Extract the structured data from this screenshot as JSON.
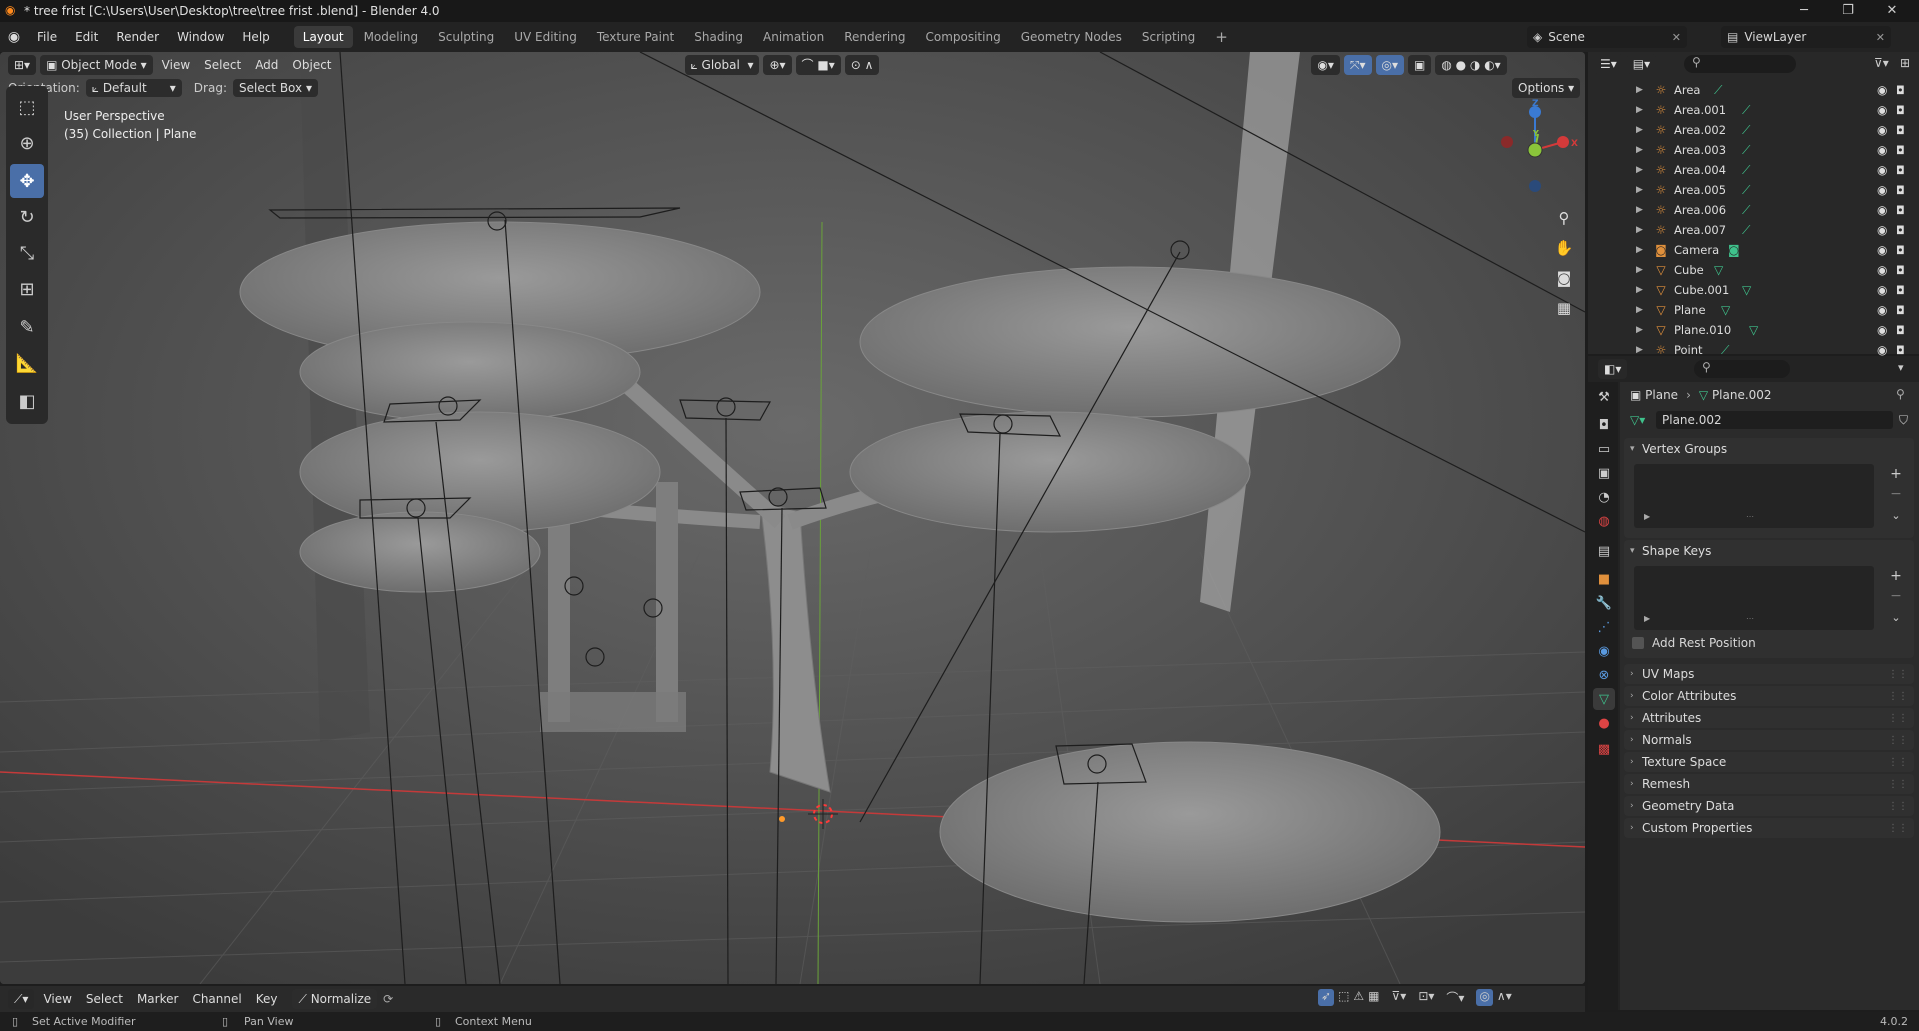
{
  "titlebar": {
    "title": "* tree frist  [C:\\Users\\User\\Desktop\\tree\\tree frist .blend] - Blender 4.0"
  },
  "menus": [
    "File",
    "Edit",
    "Render",
    "Window",
    "Help"
  ],
  "workspaces": [
    "Layout",
    "Modeling",
    "Sculpting",
    "UV Editing",
    "Texture Paint",
    "Shading",
    "Animation",
    "Rendering",
    "Compositing",
    "Geometry Nodes",
    "Scripting"
  ],
  "top_right": {
    "scene": "Scene",
    "viewlayer": "ViewLayer"
  },
  "viewport_header": {
    "mode": "Object Mode",
    "menus": [
      "View",
      "Select",
      "Add",
      "Object"
    ],
    "transform": "Global",
    "orientation_label": "Orientation:",
    "orientation_value": "Default",
    "drag_label": "Drag:",
    "drag_value": "Select Box",
    "options": "Options"
  },
  "viewport": {
    "perspective": "User Perspective",
    "collection": "(35) Collection | Plane"
  },
  "gizmo": {
    "z": "Z",
    "y": "Y",
    "x": "X"
  },
  "outliner": {
    "items": [
      {
        "name": "Area",
        "icon": "light-icon"
      },
      {
        "name": "Area.001",
        "icon": "light-icon"
      },
      {
        "name": "Area.002",
        "icon": "light-icon"
      },
      {
        "name": "Area.003",
        "icon": "light-icon"
      },
      {
        "name": "Area.004",
        "icon": "light-icon"
      },
      {
        "name": "Area.005",
        "icon": "light-icon"
      },
      {
        "name": "Area.006",
        "icon": "light-icon"
      },
      {
        "name": "Area.007",
        "icon": "light-icon"
      },
      {
        "name": "Camera",
        "icon": "camera-icon"
      },
      {
        "name": "Cube",
        "icon": "mesh-icon"
      },
      {
        "name": "Cube.001",
        "icon": "mesh-icon"
      },
      {
        "name": "Plane",
        "icon": "mesh-icon"
      },
      {
        "name": "Plane.010",
        "icon": "mesh-icon"
      },
      {
        "name": "Point",
        "icon": "light-icon"
      }
    ]
  },
  "properties": {
    "breadcrumb_object": "Plane",
    "breadcrumb_data": "Plane.002",
    "datablock": "Plane.002",
    "vertex_groups": "Vertex Groups",
    "shape_keys": "Shape Keys",
    "add_rest_position": "Add Rest Position",
    "panels": [
      "UV Maps",
      "Color Attributes",
      "Attributes",
      "Normals",
      "Texture Space",
      "Remesh",
      "Geometry Data",
      "Custom Properties"
    ]
  },
  "timeline": {
    "menus": [
      "View",
      "Select",
      "Marker",
      "Channel",
      "Key"
    ],
    "normalize": "Normalize"
  },
  "status": {
    "left": "Set Active Modifier",
    "middle": "Pan View",
    "right": "Context Menu",
    "version": "4.0.2"
  },
  "colors": {
    "accent": "#4a6fa8",
    "x_axis": "#d33a3a",
    "y_axis": "#8ac43a",
    "z_axis": "#3a7ad3",
    "mesh_icon": "#3fc28c",
    "light_icon": "#e0903c"
  }
}
